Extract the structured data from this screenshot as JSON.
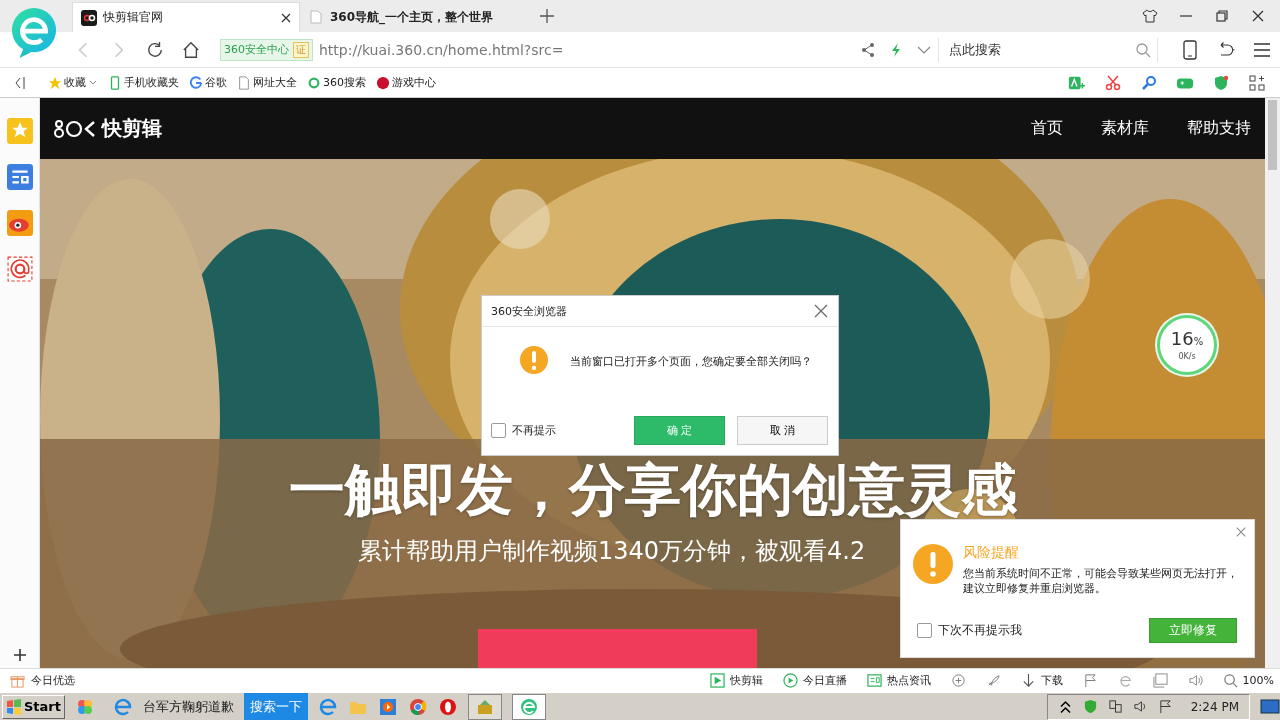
{
  "tabs": [
    {
      "title": "快剪辑官网",
      "selected": true
    },
    {
      "title": "360导航_一个主页，整个世界",
      "selected": false
    }
  ],
  "address": {
    "badge": "360安全中心",
    "badge_mark": "证",
    "url": "http://kuai.360.cn/home.html?src="
  },
  "search": {
    "placeholder": "点此搜索"
  },
  "bookmarks": [
    {
      "label": "收藏",
      "kind": "star"
    },
    {
      "label": "手机收藏夹",
      "kind": "phone"
    },
    {
      "label": "谷歌",
      "kind": "google"
    },
    {
      "label": "网址大全",
      "kind": "page"
    },
    {
      "label": "360搜索",
      "kind": "ring"
    },
    {
      "label": "游戏中心",
      "kind": "game"
    }
  ],
  "site": {
    "logo": "快剪辑",
    "nav": [
      "首页",
      "素材库",
      "帮助支持"
    ],
    "headline": "一触即发，分享你的创意灵感",
    "subline": "累计帮助用户制作视频1340万分钟，被观看4.2"
  },
  "speed": {
    "percent": "16",
    "unit": "%",
    "rate": "0K/s"
  },
  "dialog": {
    "title": "360安全浏览器",
    "message": "当前窗口已打开多个页面，您确定要全部关闭吗？",
    "dont_remind": {
      "label": "不再提示",
      "checked": false
    },
    "buttons": [
      {
        "label": "确 定",
        "kind": "primary"
      },
      {
        "label": "取 消",
        "kind": "secondary"
      }
    ]
  },
  "alert": {
    "title": "风险提醒",
    "message": "您当前系统时间不正常，可能会导致某些网页无法打开，建议立即修复并重启浏览器。",
    "checkbox": {
      "label": "下次不再提示我",
      "checked": false
    },
    "button": "立即修复"
  },
  "status_bar": {
    "left": "今日优选",
    "items": [
      {
        "label": "快剪辑",
        "kind": "clip"
      },
      {
        "label": "今日直播",
        "kind": "live"
      },
      {
        "label": "热点资讯",
        "kind": "news"
      },
      {
        "label": "下载",
        "kind": "download"
      }
    ],
    "zoom": "100%"
  },
  "taskbar": {
    "start": "Start",
    "task": "台军方鞠躬道歉",
    "search": "搜索一下",
    "clock": "2:24 PM"
  }
}
